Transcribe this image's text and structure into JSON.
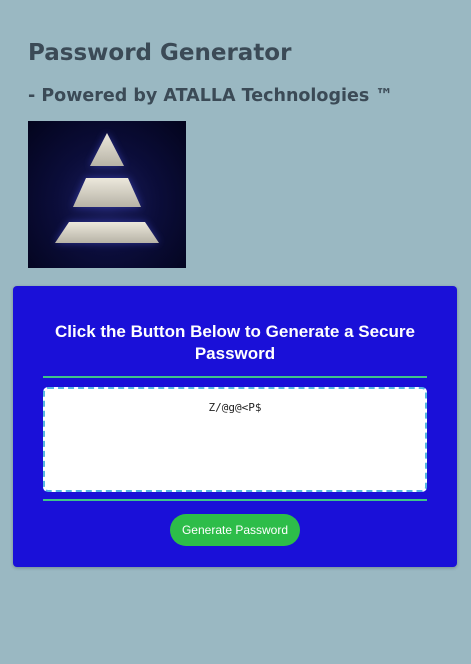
{
  "header": {
    "title": "Password Generator",
    "subtitle": "- Powered by ATALLA Technologies ™"
  },
  "logo": {
    "icon": "pyramid-logo-icon"
  },
  "card": {
    "heading": "Click the Button Below to Generate a Secure Password",
    "password_value": "Z/@g@<P$",
    "generate_button_label": "Generate Password",
    "colors": {
      "card_background": "#1a10d8",
      "divider": "#3fc48a",
      "button": "#2dbd49",
      "page_background": "#9ab8c2"
    }
  }
}
